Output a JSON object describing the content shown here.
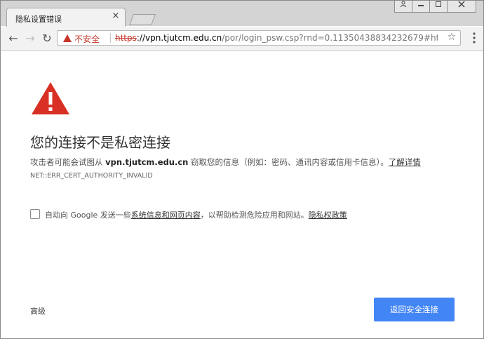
{
  "browser": {
    "tab": {
      "title": "隐私设置错误",
      "close_icon": "×"
    },
    "window_controls": [
      "user-icon",
      "minimize-icon",
      "maximize-icon",
      "close-icon"
    ],
    "toolbar": {
      "back_icon": "←",
      "forward_icon": "→",
      "reload_icon": "↻",
      "security_label": "不安全",
      "url_scheme": "https",
      "url_rest_host": "://vpn.tjutcm.edu.cn",
      "url_path": "/por/login_psw.csp?rnd=0.11350438834232679#htt...",
      "star_icon": "☆",
      "menu_icon": "⋮"
    }
  },
  "colors": {
    "danger": "#c6352a",
    "primary_button": "#4285f4"
  },
  "content": {
    "heading": "您的连接不是私密连接",
    "desc_prefix": "攻击者可能会试图从 ",
    "desc_host": "vpn.tjutcm.edu.cn",
    "desc_suffix": " 窃取您的信息（例如：密码、通讯内容或信用卡信息）。",
    "learn_more": "了解详情",
    "error_code": "NET::ERR_CERT_AUTHORITY_INVALID",
    "optin_prefix": "自动向 Google 发送一些",
    "optin_link1": "系统信息和网页内容",
    "optin_middle": "，以帮助检测危险应用和网站。",
    "optin_link2": "隐私权政策",
    "advanced": "高级",
    "back_button": "返回安全连接"
  }
}
